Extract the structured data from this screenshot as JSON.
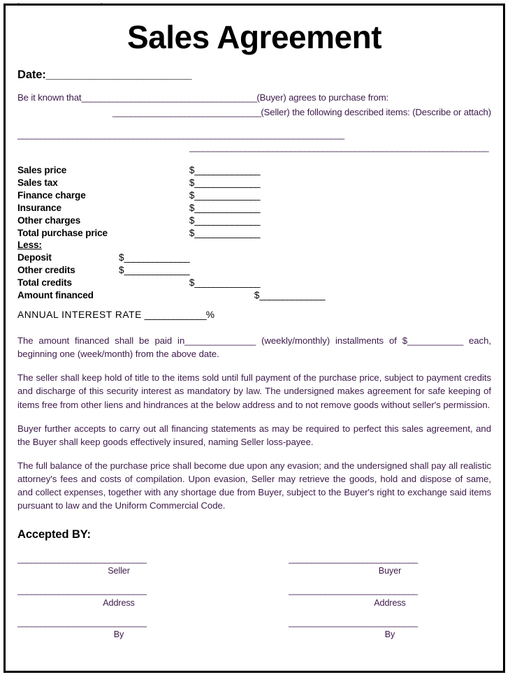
{
  "document": {
    "header_label": "Sales Agreement Template",
    "title": "Sales Agreement",
    "accent_text_color": "#3d1a4a",
    "primary_text_color": "#000000",
    "border_color": "#000000"
  },
  "date_field": {
    "label": "Date:",
    "blank": "________________________"
  },
  "intro": {
    "line1_prefix": "Be it known that",
    "line1_blank": "_______________________________________",
    "line1_suffix": "(Buyer) agrees to purchase from:",
    "line2_blank": "_________________________________",
    "line2_suffix": "(Seller)  the following described items:   (Describe or attach)",
    "blank_line_1": "_______________________________________________________________________",
    "blank_line_2": "_________________________________________________________________"
  },
  "price_table": {
    "amount_blank": "______________",
    "dollar_sign": "$",
    "rows": [
      {
        "label": "Sales price",
        "indent": "right",
        "amount": true
      },
      {
        "label": "Sales tax",
        "indent": "right",
        "amount": true
      },
      {
        "label": "Finance charge",
        "indent": "right",
        "amount": true
      },
      {
        "label": "Insurance",
        "indent": "right",
        "amount": true
      },
      {
        "label": "Other charges",
        "indent": "right",
        "amount": true
      },
      {
        "label": "Total purchase price",
        "indent": "right",
        "amount": true
      },
      {
        "label": "Less:",
        "indent": "none",
        "amount": false
      },
      {
        "label": "Deposit",
        "indent": "mid",
        "amount": true
      },
      {
        "label": "Other credits",
        "indent": "mid",
        "amount": true
      },
      {
        "label": "Total credits",
        "indent": "right",
        "amount": true
      },
      {
        "label": "Amount financed",
        "indent": "far",
        "amount": true
      }
    ]
  },
  "annual_rate": {
    "label": "ANNUAL  INTEREST  RATE",
    "blank": "_____________",
    "suffix": "%"
  },
  "paragraphs": {
    "installments": "The amount financed shall be paid in______________ (weekly/monthly) installments of $___________ each, beginning one (week/month) from the above date.",
    "title_retention": "The seller shall keep hold of title to the items sold until full payment of the purchase price, subject to payment credits and discharge of this security interest as mandatory by law. The undersigned makes agreement for safe keeping of items free from other liens and hindrances at the below address and to not remove goods without seller's permission.",
    "financing_statements": "Buyer further accepts to carry out all financing statements as may be required to perfect this sales agreement, and the Buyer shall keep goods effectively insured, naming Seller loss-payee.",
    "default_remedies": "The full balance of the purchase price shall become due upon any evasion; and the undersigned shall pay all realistic attorney's fees and costs of compilation. Upon evasion, Seller may retrieve the goods, hold and dispose of same, and collect expenses, together with any shortage due from Buyer, subject to the Buyer's right to exchange said items pursuant to law and the Uniform Commercial Code."
  },
  "signatures": {
    "heading": "Accepted BY:",
    "rule": "____________________________",
    "rows": [
      {
        "left_caption": "Seller",
        "right_caption": "Buyer"
      },
      {
        "left_caption": "Address",
        "right_caption": "Address"
      },
      {
        "left_caption": "By",
        "right_caption": "By"
      }
    ]
  }
}
